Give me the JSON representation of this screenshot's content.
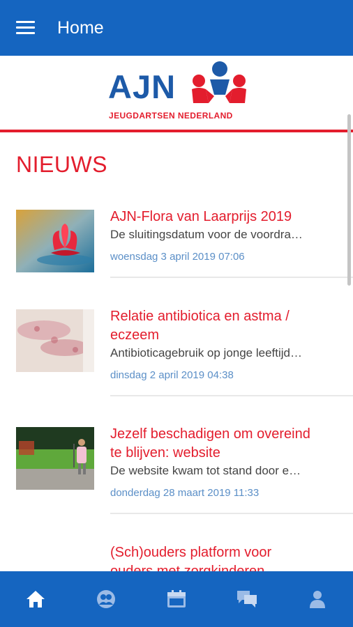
{
  "app_bar": {
    "title": "Home",
    "menu_icon": "menu-icon"
  },
  "logo": {
    "letters": "AJN",
    "subtitle": "JEUGDARTSEN NEDERLAND"
  },
  "section": {
    "title": "NIEUWS"
  },
  "news": [
    {
      "title_line1": "AJN-Flora van Laarprijs 2019",
      "title_line2": "",
      "description": "De sluitingsdatum voor de voordra…",
      "date": "woensdag 3 april 2019 07:06",
      "thumb": "water-lily-photo"
    },
    {
      "title_line1": "Relatie antibiotica en astma /",
      "title_line2": "eczeem",
      "description": "Antibioticagebruik op jonge leeftijd…",
      "date": "dinsdag 2 april 2019 04:38",
      "thumb": "skin-rash-photo"
    },
    {
      "title_line1": "Jezelf beschadigen om overeind",
      "title_line2": "te blijven: website",
      "description": "De website kwam tot stand door e…",
      "date": "donderdag 28 maart 2019 11:33",
      "thumb": "playground-child-photo"
    },
    {
      "title_line1": "(Sch)ouders platform voor",
      "title_line2": "ouders met zorgkinderen",
      "description": "",
      "date": "",
      "thumb": "handwriting-logo"
    }
  ],
  "bottom_nav": [
    "home-icon",
    "group-icon",
    "calendar-icon",
    "chat-icon",
    "person-icon"
  ],
  "colors": {
    "primary": "#1565c0",
    "accent_red": "#e31d2d",
    "date_blue": "#5b8fc7"
  }
}
